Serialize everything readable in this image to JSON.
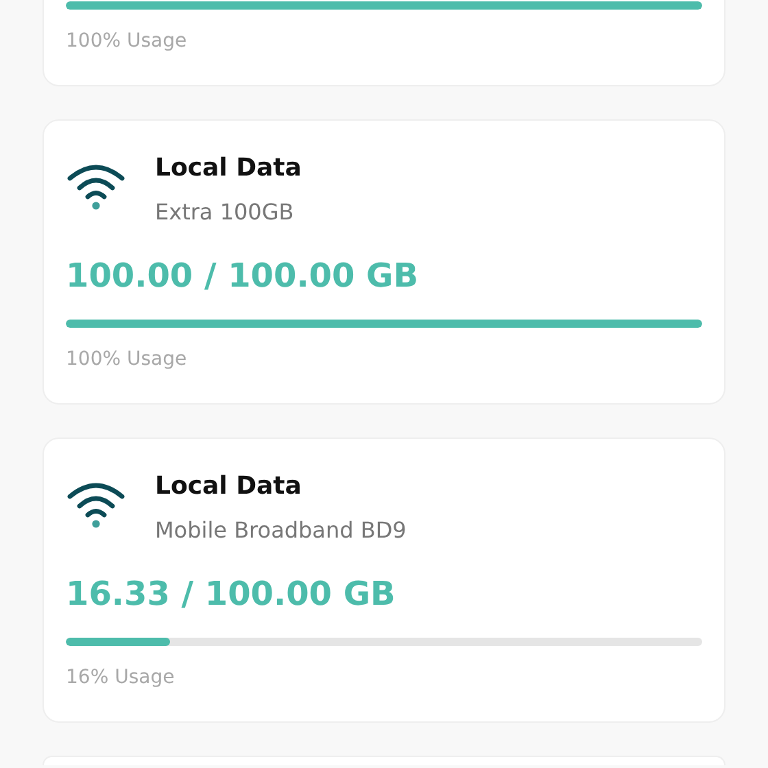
{
  "cards": [
    {
      "level": 1,
      "usage": "100% Usage"
    },
    {
      "title": "Local Data",
      "subtitle": "Extra 100GB",
      "amount": "100.00 / 100.00 GB",
      "level": 1,
      "usage": "100% Usage"
    },
    {
      "title": "Local Data",
      "subtitle": "Mobile Broadband BD9",
      "amount": "16.33 / 100.00 GB",
      "level": 0.1633,
      "usage": "16% Usage"
    }
  ]
}
